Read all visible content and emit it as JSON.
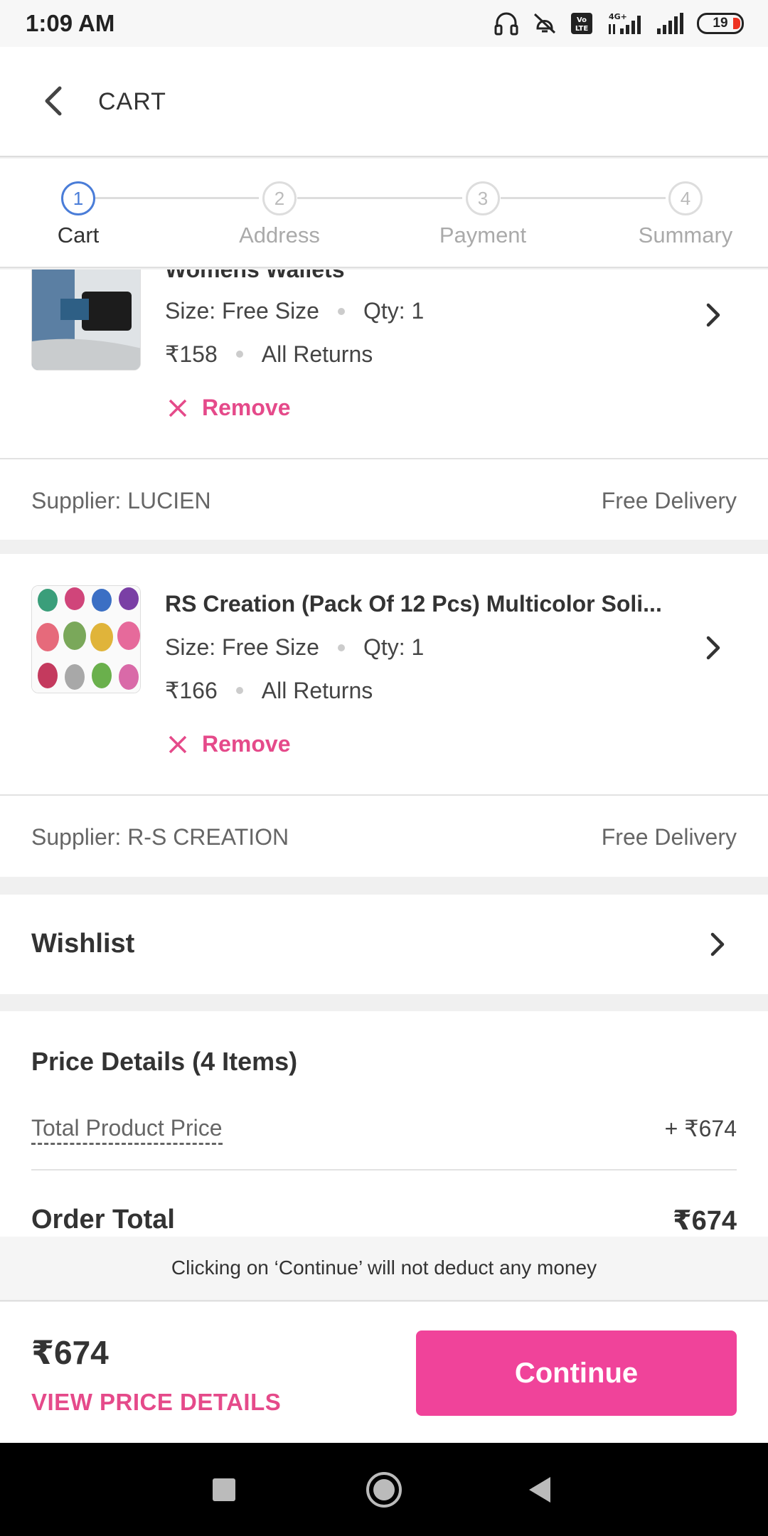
{
  "status_bar": {
    "time": "1:09 AM",
    "battery": "19",
    "network": "4G+",
    "icons": [
      "headset-icon",
      "mute-vibrate-icon",
      "volte-icon",
      "signal-4g-icon",
      "signal-icon",
      "battery-icon"
    ]
  },
  "header": {
    "title": "CART",
    "back_icon": "back-arrow-icon"
  },
  "stepper": {
    "active_index": 0,
    "accent_color": "#4a7dd8",
    "steps": [
      {
        "number": "1",
        "label": "Cart"
      },
      {
        "number": "2",
        "label": "Address"
      },
      {
        "number": "3",
        "label": "Payment"
      },
      {
        "number": "4",
        "label": "Summary"
      }
    ]
  },
  "cart_items": [
    {
      "title": "Womens Wallets",
      "size": "Size: Free Size",
      "qty": "Qty: 1",
      "price": "₹158",
      "returns": "All Returns",
      "remove_label": "Remove",
      "supplier": "Supplier: LUCIEN",
      "delivery": "Free Delivery"
    },
    {
      "title": "RS Creation (Pack Of 12 Pcs) Multicolor Soli...",
      "size": "Size: Free Size",
      "qty": "Qty: 1",
      "price": "₹166",
      "returns": "All Returns",
      "remove_label": "Remove",
      "supplier": "Supplier: R-S CREATION",
      "delivery": "Free Delivery"
    }
  ],
  "wishlist": {
    "label": "Wishlist"
  },
  "price_details": {
    "title": "Price Details (4 Items)",
    "total_product_price_label": "Total Product Price",
    "total_product_price_value": "+  ₹674",
    "order_total_label": "Order Total",
    "order_total_value": "₹674"
  },
  "info_strip": {
    "text": "Clicking on ‘Continue’ will not deduct any money"
  },
  "bottom_bar": {
    "total": "₹674",
    "view_price_details": "VIEW PRICE DETAILS",
    "continue_label": "Continue",
    "accent_color": "#f0439a"
  },
  "nav_bar": {
    "icons": [
      "recents-square-icon",
      "home-circle-icon",
      "back-triangle-icon"
    ]
  },
  "colors": {
    "brand_pink": "#e54a8a",
    "continue_pink": "#f0439a",
    "step_blue": "#4a7dd8"
  }
}
